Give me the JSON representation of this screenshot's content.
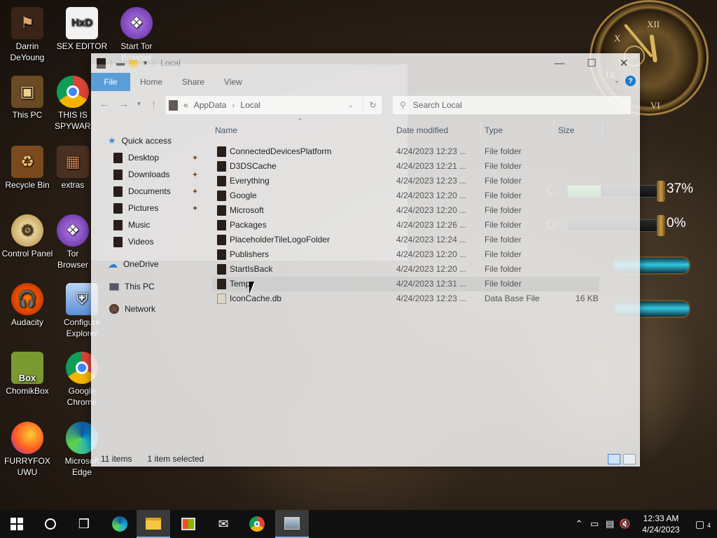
{
  "desktop": {
    "icons": [
      {
        "label": "Darrin DeYoung",
        "icon": "user-folder-icon"
      },
      {
        "label": "SEX EDITOR",
        "icon": "hxd-editor-icon"
      },
      {
        "label": "Start Tor Browser",
        "icon": "tor-browser-icon"
      },
      {
        "label": "This PC",
        "icon": "computer-icon"
      },
      {
        "label": "THIS IS SPYWARE",
        "icon": "chrome-icon"
      },
      {
        "label": "Recycle Bin",
        "icon": "recycle-bin-icon"
      },
      {
        "label": "extras",
        "icon": "folder-icon"
      },
      {
        "label": "Control Panel",
        "icon": "control-panel-icon"
      },
      {
        "label": "Tor Browser",
        "icon": "tor-browser-icon"
      },
      {
        "label": "Audacity",
        "icon": "audacity-icon"
      },
      {
        "label": "Configure Explorer",
        "icon": "shield-icon"
      },
      {
        "label": "ChomikBox",
        "icon": "chomikbox-icon"
      },
      {
        "label": "Google Chrome",
        "icon": "chrome-icon"
      },
      {
        "label": "FURRYFOX UWU",
        "icon": "firefox-icon"
      },
      {
        "label": "Microsoft Edge",
        "icon": "edge-icon"
      }
    ],
    "drive_widgets": [
      {
        "letter": "C:",
        "percent": "37%",
        "fill": 0.37
      },
      {
        "letter": "D:",
        "percent": "0%",
        "fill": 0.0
      }
    ],
    "clock_dial": "24"
  },
  "window": {
    "title": "Local",
    "ribbon_tabs": [
      "File",
      "Home",
      "Share",
      "View"
    ],
    "address": {
      "overflow": "«",
      "segments": [
        "AppData",
        "Local"
      ]
    },
    "search_placeholder": "Search Local",
    "nav": {
      "quick_access": "Quick access",
      "pinned": [
        "Desktop",
        "Downloads",
        "Documents",
        "Pictures"
      ],
      "other": [
        "Music",
        "Videos"
      ],
      "onedrive": "OneDrive",
      "this_pc": "This PC",
      "network": "Network"
    },
    "columns": [
      "Name",
      "Date modified",
      "Type",
      "Size"
    ],
    "files": [
      {
        "name": "ConnectedDevicesPlatform",
        "date": "4/24/2023 12:23 ...",
        "type": "File folder",
        "size": ""
      },
      {
        "name": "D3DSCache",
        "date": "4/24/2023 12:21 ...",
        "type": "File folder",
        "size": ""
      },
      {
        "name": "Everything",
        "date": "4/24/2023 12:23 ...",
        "type": "File folder",
        "size": ""
      },
      {
        "name": "Google",
        "date": "4/24/2023 12:20 ...",
        "type": "File folder",
        "size": ""
      },
      {
        "name": "Microsoft",
        "date": "4/24/2023 12:20 ...",
        "type": "File folder",
        "size": ""
      },
      {
        "name": "Packages",
        "date": "4/24/2023 12:26 ...",
        "type": "File folder",
        "size": ""
      },
      {
        "name": "PlaceholderTileLogoFolder",
        "date": "4/24/2023 12:24 ...",
        "type": "File folder",
        "size": ""
      },
      {
        "name": "Publishers",
        "date": "4/24/2023 12:20 ...",
        "type": "File folder",
        "size": ""
      },
      {
        "name": "StartIsBack",
        "date": "4/24/2023 12:20 ...",
        "type": "File folder",
        "size": ""
      },
      {
        "name": "Temp",
        "date": "4/24/2023 12:31 ...",
        "type": "File folder",
        "size": "",
        "selected": true
      },
      {
        "name": "IconCache.db",
        "date": "4/24/2023 12:23 ...",
        "type": "Data Base File",
        "size": "16 KB"
      }
    ],
    "status": {
      "item_count": "11 items",
      "selection": "1 item selected"
    }
  },
  "taskbar": {
    "time": "12:33 AM",
    "date": "4/24/2023",
    "notification_count": "4",
    "apps": [
      "start-icon",
      "cortana-icon",
      "task-view-icon",
      "edge-icon",
      "file-explorer-icon",
      "store-icon",
      "mail-icon",
      "chrome-icon",
      "image-viewer-icon"
    ]
  },
  "colors": {
    "accent": "#1979ca",
    "selection": "#cdcdcd"
  }
}
